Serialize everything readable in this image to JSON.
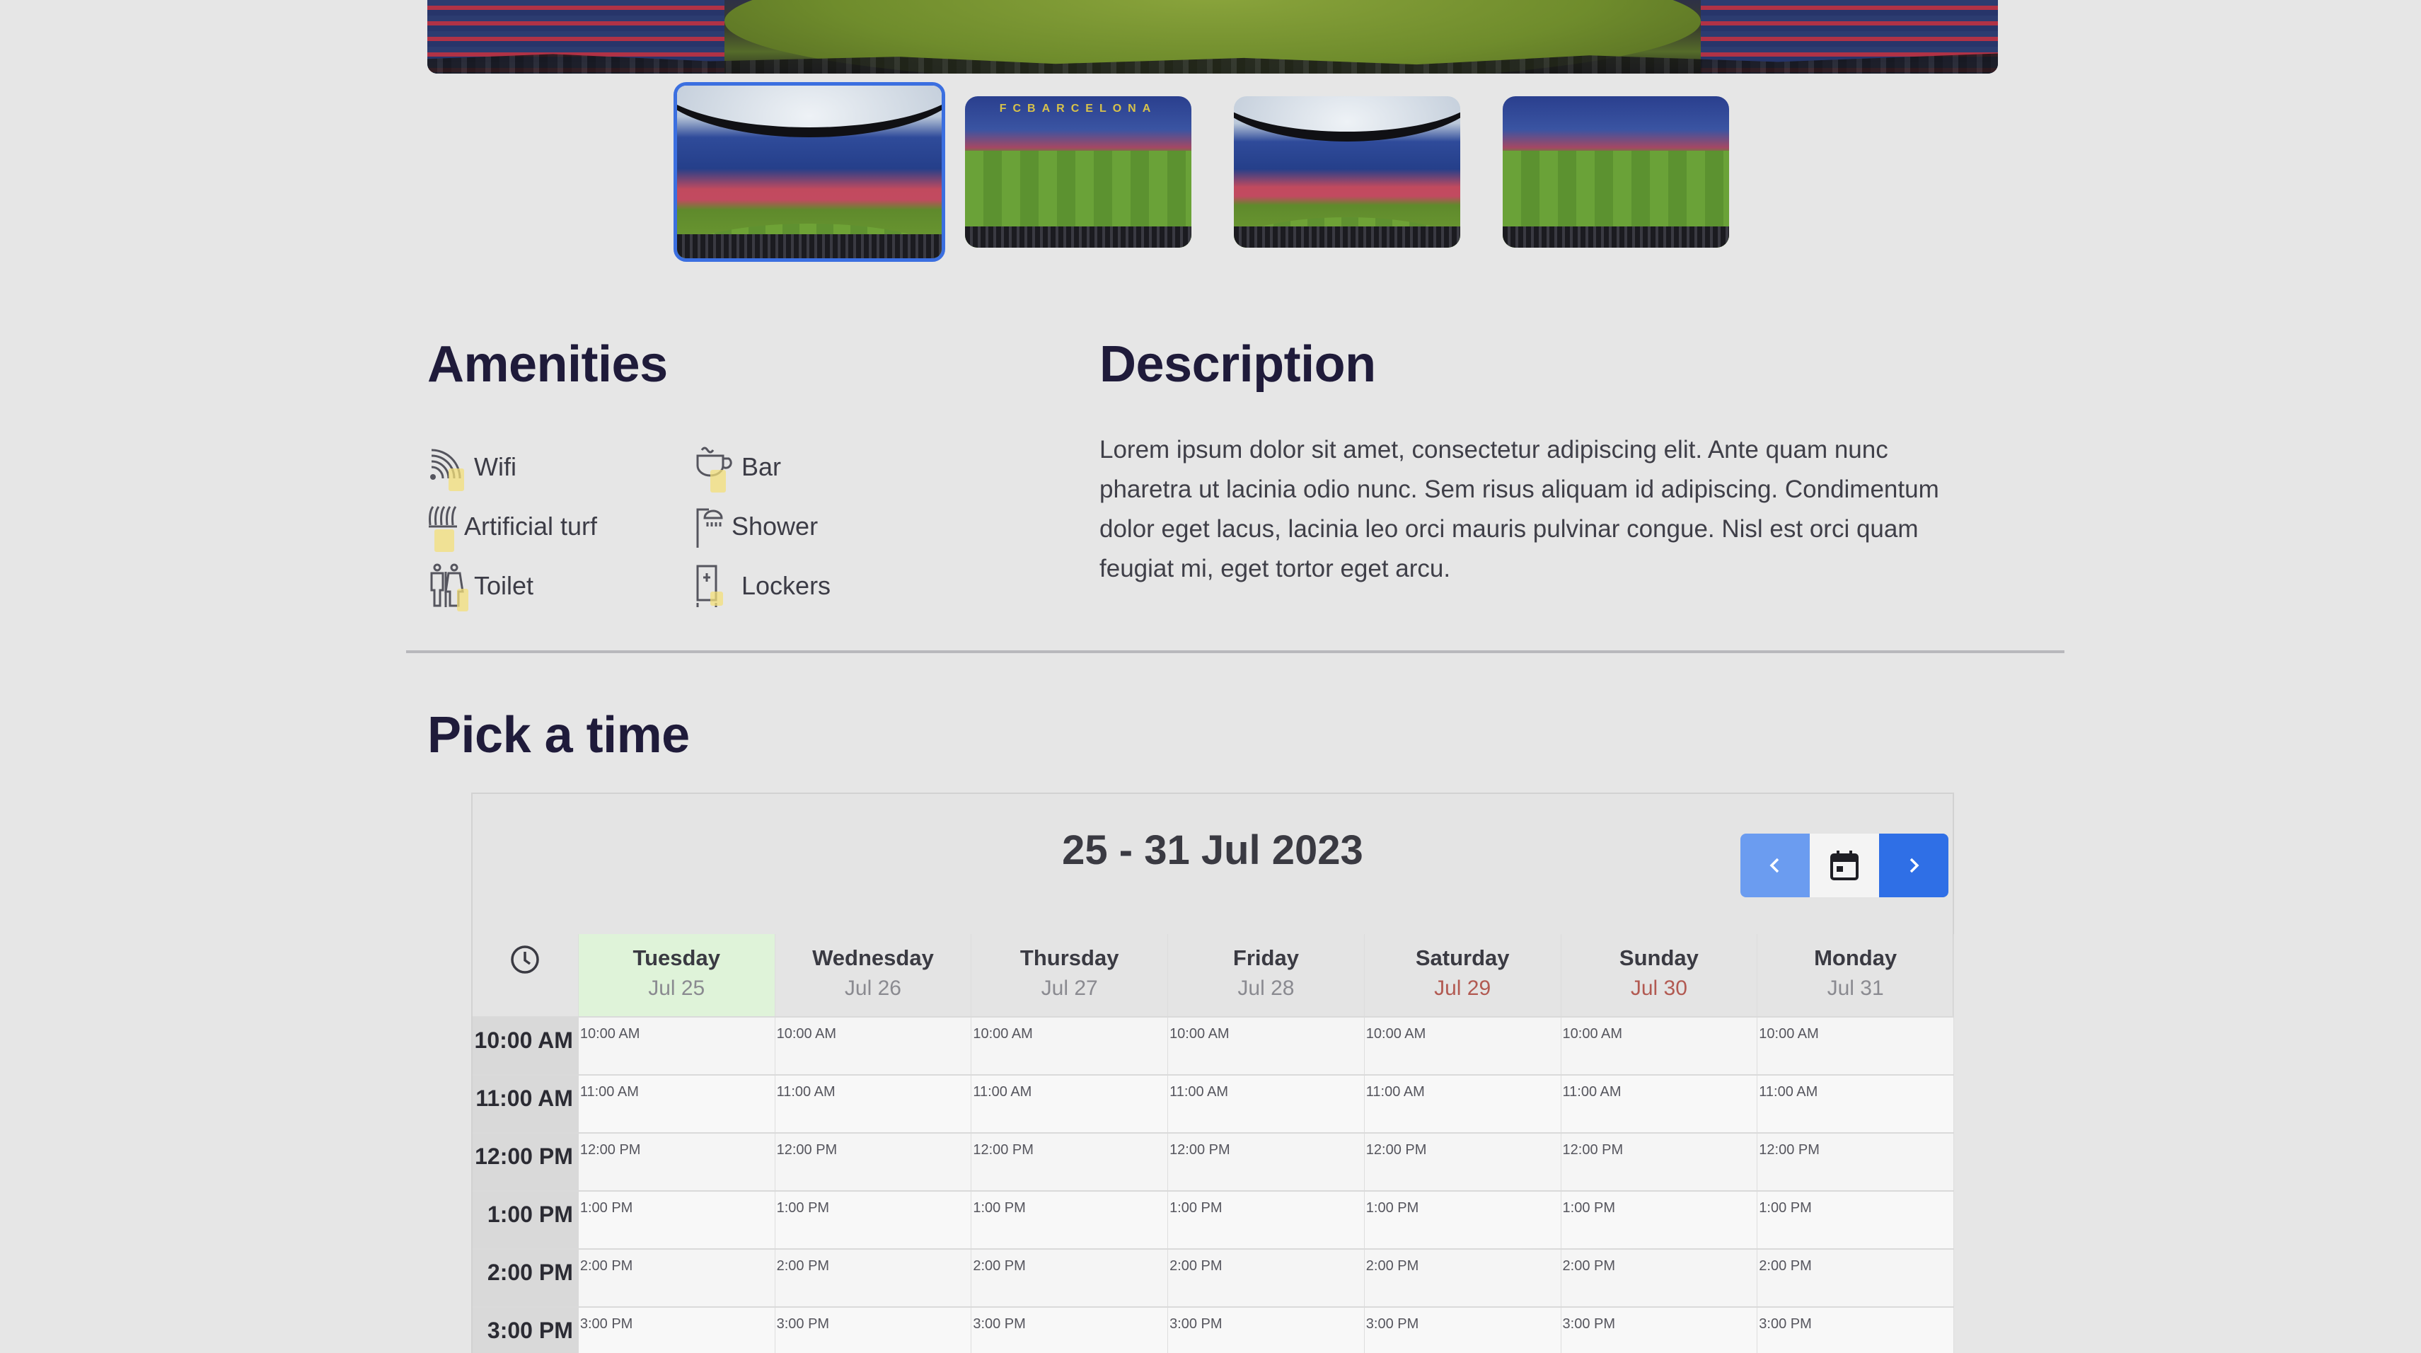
{
  "gallery": {
    "thumbnails": [
      {
        "alt": "stadium-view-1",
        "selected": true
      },
      {
        "alt": "stadium-view-2",
        "selected": false,
        "banner": "FCBARCELONA"
      },
      {
        "alt": "stadium-view-3",
        "selected": false
      },
      {
        "alt": "stadium-view-4",
        "selected": false
      }
    ]
  },
  "amenities": {
    "title": "Amenities",
    "items": [
      {
        "label": "Wifi",
        "icon": "wifi-icon"
      },
      {
        "label": "Bar",
        "icon": "cup-icon"
      },
      {
        "label": "Artificial turf",
        "icon": "turf-icon"
      },
      {
        "label": "Shower",
        "icon": "shower-icon"
      },
      {
        "label": "Toilet",
        "icon": "toilet-icon"
      },
      {
        "label": "Lockers",
        "icon": "locker-icon"
      }
    ],
    "highlight_color": "#f3df7a"
  },
  "description": {
    "title": "Description",
    "text": "Lorem ipsum dolor sit amet, consectetur adipiscing elit. Ante quam nunc pharetra ut lacinia odio nunc. Sem risus aliquam id adipiscing. Condimentum dolor eget lacus, lacinia leo orci mauris pulvinar congue. Nisl est orci quam feugiat mi, eget tortor eget arcu."
  },
  "scheduler": {
    "title": "Pick a time",
    "range_label": "25 - 31 Jul 2023",
    "nav": {
      "prev_icon": "chevron-left-icon",
      "today_icon": "calendar-icon",
      "next_icon": "chevron-right-icon"
    },
    "colors": {
      "today_bg": "#dff3d9",
      "weekend_date": "#b25a52",
      "nav_primary": "#2f6fe6",
      "nav_light": "#6b9cf0"
    },
    "days": [
      {
        "name": "Tuesday",
        "date": "Jul 25",
        "today": true,
        "weekend": false
      },
      {
        "name": "Wednesday",
        "date": "Jul 26",
        "today": false,
        "weekend": false
      },
      {
        "name": "Thursday",
        "date": "Jul 27",
        "today": false,
        "weekend": false
      },
      {
        "name": "Friday",
        "date": "Jul 28",
        "today": false,
        "weekend": false
      },
      {
        "name": "Saturday",
        "date": "Jul 29",
        "today": false,
        "weekend": true
      },
      {
        "name": "Sunday",
        "date": "Jul 30",
        "today": false,
        "weekend": true
      },
      {
        "name": "Monday",
        "date": "Jul 31",
        "today": false,
        "weekend": false
      }
    ],
    "times": [
      "10:00 AM",
      "11:00 AM",
      "12:00 PM",
      "1:00 PM",
      "2:00 PM",
      "3:00 PM"
    ]
  }
}
